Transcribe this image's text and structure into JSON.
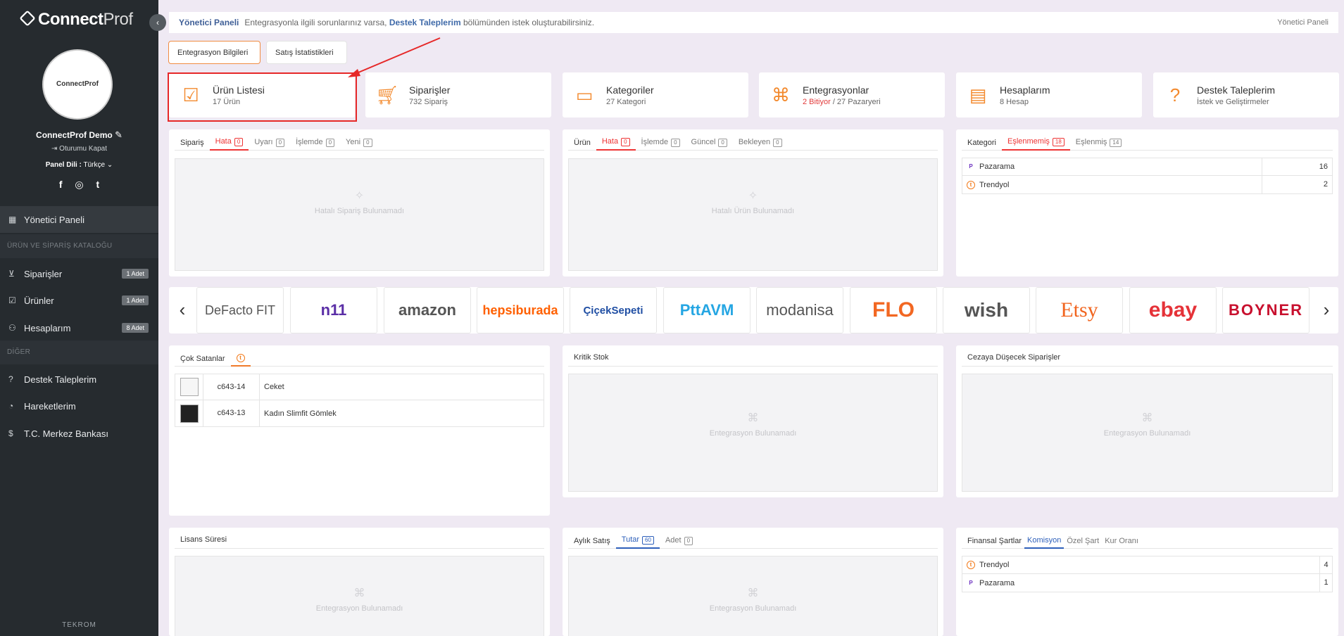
{
  "sidebar": {
    "logo_bold": "Connect",
    "logo_thin": "Prof",
    "avatar_text": "ConnectProf",
    "user_name": "ConnectProf Demo",
    "logout": "Oturumu Kapat",
    "lang_label": "Panel Dili :",
    "lang_value": "Türkçe",
    "social": [
      "f",
      "◎",
      "t"
    ],
    "dashboard": "Yönetici Paneli",
    "section1": "ÜRÜN VE SİPARİŞ KATALOĞU",
    "orders": "Siparişler",
    "orders_badge": "1 Adet",
    "products": "Ürünler",
    "products_badge": "1 Adet",
    "accounts": "Hesaplarım",
    "accounts_badge": "8 Adet",
    "section2": "DİĞER",
    "support": "Destek Taleplerim",
    "movements": "Hareketlerim",
    "bank": "T.C. Merkez Bankası",
    "footer": "TEKROM"
  },
  "topbar": {
    "title": "Yönetici Paneli",
    "msg_pre": "Entegrasyonla ilgili sorunlarınız varsa,",
    "link": "Destek Taleplerim",
    "msg_post": "bölümünden istek oluşturabilirsiniz.",
    "breadcrumb": "Yönetici Paneli"
  },
  "tabs": {
    "info": "Entegrasyon Bilgileri",
    "stats": "Satış İstatistikleri"
  },
  "stats": [
    {
      "title": "Ürün Listesi",
      "sub": "17 Ürün",
      "icon": "clipboard-check-icon"
    },
    {
      "title": "Siparişler",
      "sub": "732 Sipariş",
      "icon": "cart-icon"
    },
    {
      "title": "Kategoriler",
      "sub": "27 Kategori",
      "icon": "folder-icon"
    },
    {
      "title": "Entegrasyonlar",
      "sub_red": "2 Bitiyor",
      "sub": "/ 27 Pazaryeri",
      "icon": "webhook-icon"
    },
    {
      "title": "Hesaplarım",
      "sub": "8 Hesap",
      "icon": "id-card-icon"
    },
    {
      "title": "Destek Taleplerim",
      "sub": "İstek ve Geliştirmeler",
      "icon": "question-icon"
    }
  ],
  "order_panel": {
    "tabs": [
      "Sipariş",
      "Hata",
      "Uyarı",
      "İşlemde",
      "Yeni"
    ],
    "counts": [
      "0",
      "0",
      "0",
      "0"
    ],
    "empty": "Hatalı Sipariş Bulunamadı"
  },
  "product_panel": {
    "tabs": [
      "Ürün",
      "Hata",
      "İşlemde",
      "Güncel",
      "Bekleyen"
    ],
    "counts": [
      "0",
      "0",
      "0",
      "0"
    ],
    "empty": "Hatalı Ürün Bulunamadı"
  },
  "category_panel": {
    "tabs": [
      "Kategori",
      "Eşlenmemiş",
      "Eşlenmiş"
    ],
    "counts": [
      "18",
      "14"
    ],
    "rows": [
      {
        "mark": "P",
        "name": "Pazarama",
        "value": "16"
      },
      {
        "mark": "t",
        "name": "Trendyol",
        "value": "2"
      }
    ]
  },
  "brands": [
    "DeFacto FIT",
    "n11",
    "amazon",
    "hepsiburada",
    "ÇiçekSepeti",
    "PttAVM",
    "modanisa",
    "FLO",
    "wish",
    "Etsy",
    "ebay",
    "BOYNER"
  ],
  "brand_colors": [
    "#111111",
    "#5a2ea6",
    "#111111",
    "#ff6000",
    "#1f4ea3",
    "#25a6e3",
    "#222222",
    "#f26722",
    "#222222",
    "#f1641e",
    "#e53238",
    "#c8102e"
  ],
  "bestsellers": {
    "title": "Çok Satanlar",
    "rows": [
      {
        "code": "c643-14",
        "name": "Ceket"
      },
      {
        "code": "c643-13",
        "name": "Kadın Slimfit Gömlek"
      }
    ]
  },
  "critical_stock": {
    "title": "Kritik Stok",
    "empty": "Entegrasyon Bulunamadı"
  },
  "penalty": {
    "title": "Cezaya Düşecek Siparişler",
    "empty": "Entegrasyon Bulunamadı"
  },
  "license": {
    "title": "Lisans Süresi",
    "empty": "Entegrasyon Bulunamadı"
  },
  "monthly": {
    "tabs": [
      "Aylık Satış",
      "Tutar",
      "Adet"
    ],
    "counts": [
      "60",
      "0"
    ],
    "empty": "Entegrasyon Bulunamadı"
  },
  "finance": {
    "tabs": [
      "Finansal Şartlar",
      "Komisyon",
      "Özel Şart",
      "Kur Oranı"
    ],
    "rows": [
      {
        "mark": "t",
        "name": "Trendyol",
        "value": "4"
      },
      {
        "mark": "P",
        "name": "Pazarama",
        "value": "1"
      }
    ]
  }
}
